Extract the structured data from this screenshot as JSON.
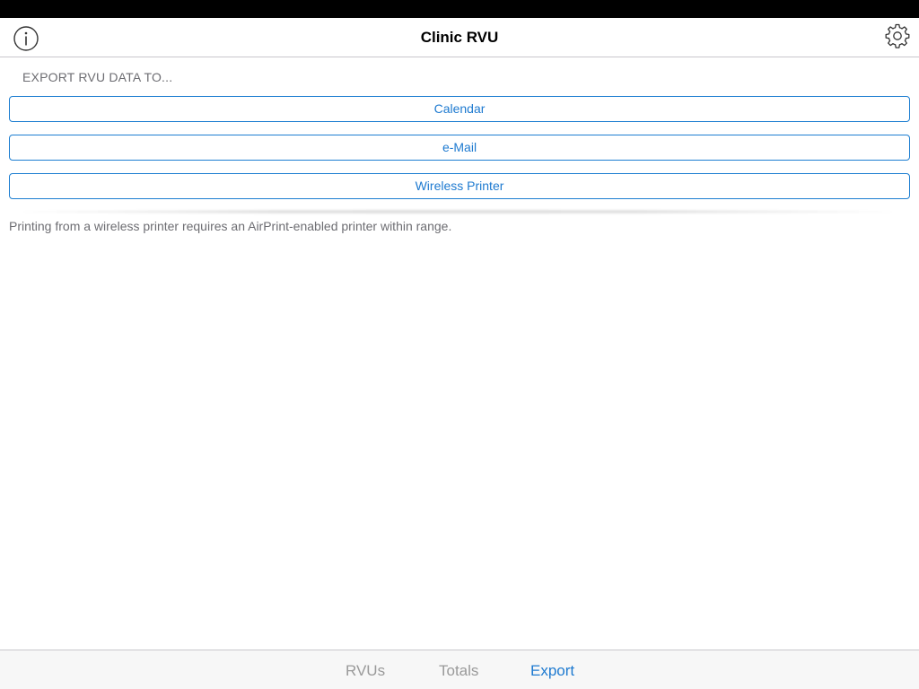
{
  "nav": {
    "title": "Clinic RVU",
    "info_icon": "info-icon",
    "settings_icon": "gear-icon"
  },
  "export": {
    "header": "EXPORT RVU DATA TO...",
    "buttons": [
      {
        "label": "Calendar"
      },
      {
        "label": "e-Mail"
      },
      {
        "label": "Wireless Printer"
      }
    ],
    "note": "Printing from a wireless printer requires an AirPrint-enabled printer within range."
  },
  "tabs": [
    {
      "label": "RVUs",
      "selected": false
    },
    {
      "label": "Totals",
      "selected": false
    },
    {
      "label": "Export",
      "selected": true
    }
  ],
  "colors": {
    "accent": "#1e7ad0",
    "inactive_tab": "#9a9a9a",
    "secondary_text": "#6d6d72"
  }
}
